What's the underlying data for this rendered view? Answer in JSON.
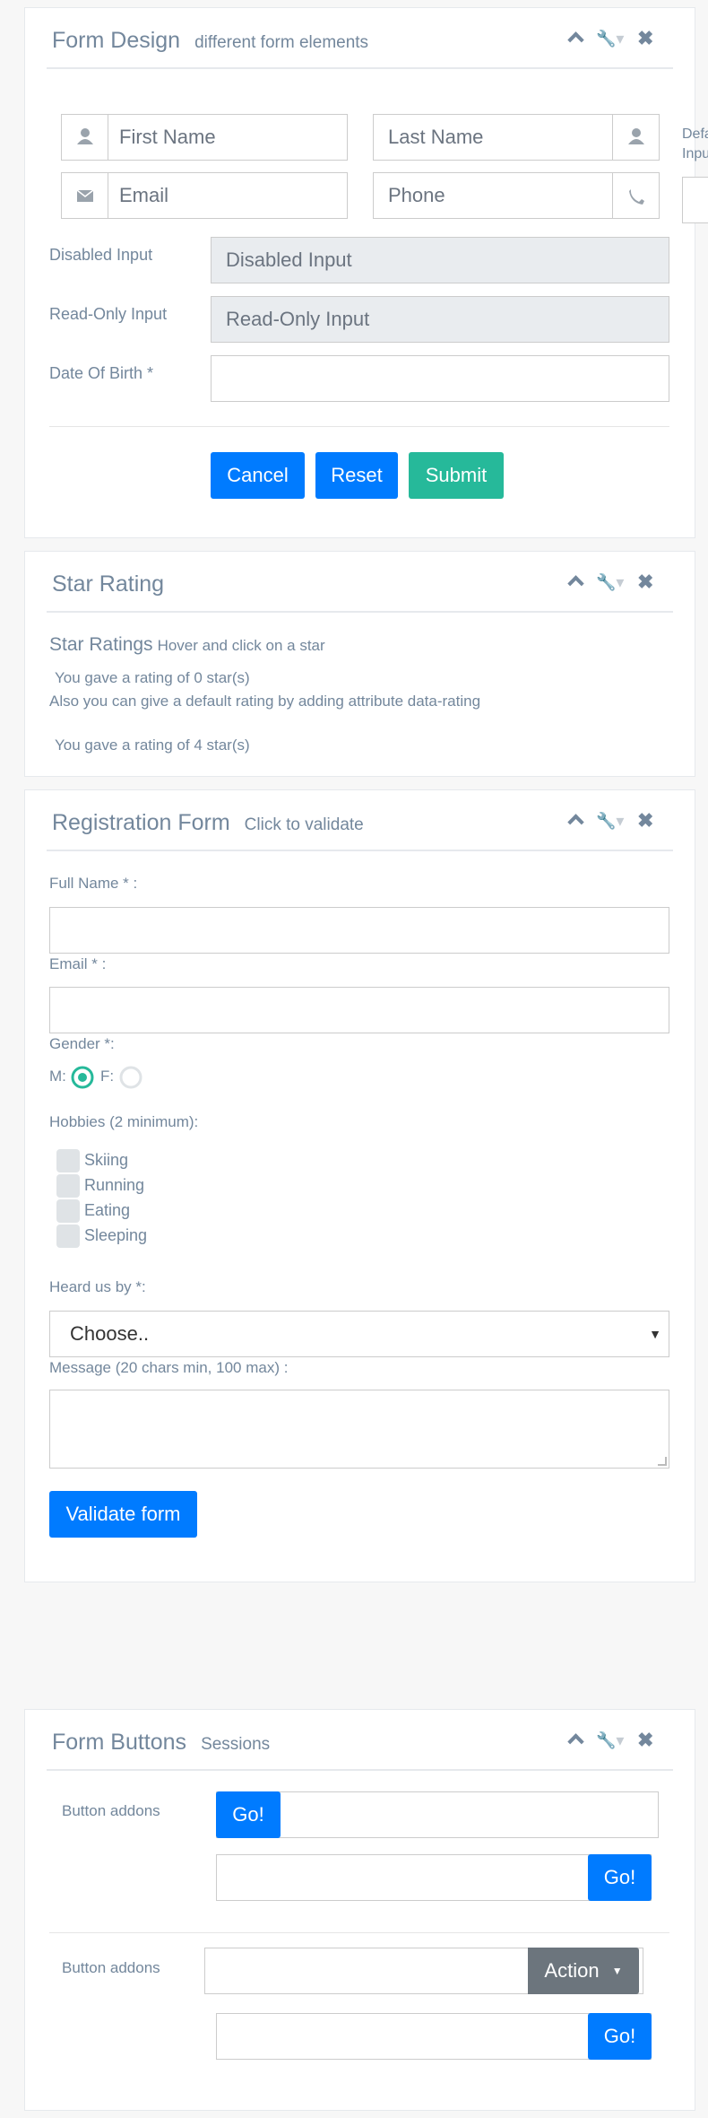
{
  "form_design": {
    "title": "Form Design",
    "subtitle": "different form elements",
    "first_name_placeholder": "First Name",
    "last_name_placeholder": "Last Name",
    "email_placeholder": "Email",
    "phone_placeholder": "Phone",
    "default_label_fragment_1": "Defa",
    "default_label_fragment_2": "Inpu",
    "disabled_label": "Disabled Input",
    "disabled_value": "Disabled Input",
    "readonly_label": "Read-Only Input",
    "readonly_value": "Read-Only Input",
    "dob_label": "Date Of Birth *",
    "cancel": "Cancel",
    "reset": "Reset",
    "submit": "Submit"
  },
  "star_rating": {
    "title": "Star Rating",
    "heading": "Star Ratings",
    "hint": "Hover and click on a star",
    "rating1": "You gave a rating of 0 star(s)",
    "note": "Also you can give a default rating by adding attribute data-rating",
    "rating2": "You gave a rating of 4 star(s)"
  },
  "registration": {
    "title": "Registration Form",
    "subtitle": "Click to validate",
    "full_name_label": "Full Name * :",
    "email_label": "Email * :",
    "gender_label": "Gender *:",
    "male": "M:",
    "female": "F:",
    "gender_selected": "M",
    "hobbies_label": "Hobbies (2 minimum):",
    "hobbies": [
      "Skiing",
      "Running",
      "Eating",
      "Sleeping"
    ],
    "heard_label": "Heard us by *:",
    "heard_selected": "Choose..",
    "message_label": "Message (20 chars min, 100 max) :",
    "validate": "Validate form"
  },
  "form_buttons": {
    "title": "Form Buttons",
    "subtitle": "Sessions",
    "addons_label_1": "Button addons",
    "addons_label_2": "Button addons",
    "go": "Go!",
    "action": "Action"
  },
  "colors": {
    "primary": "#007bff",
    "success": "#26b99a",
    "secondary": "#6c757d",
    "text": "#73879c"
  }
}
